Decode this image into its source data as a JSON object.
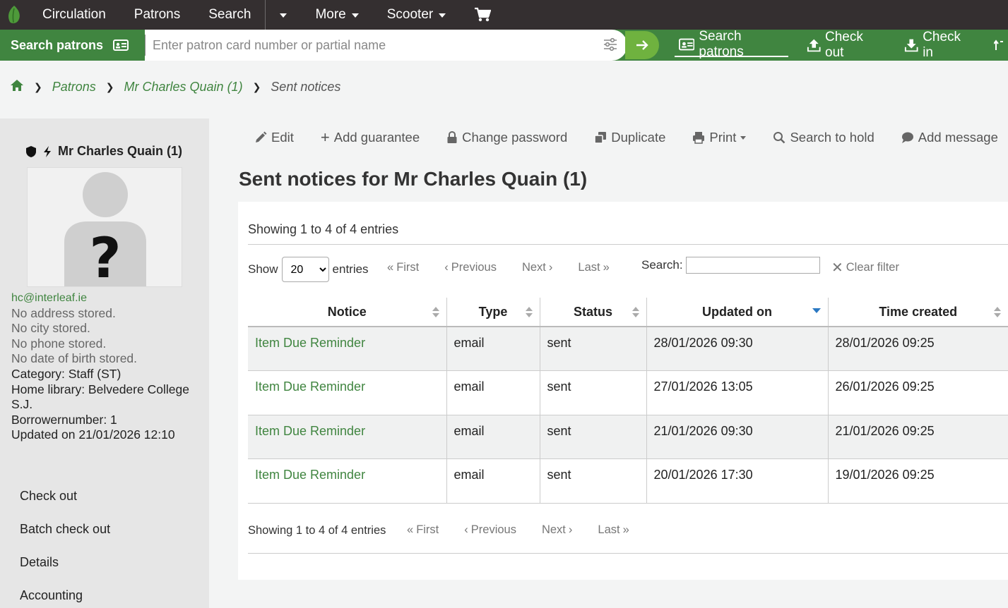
{
  "topnav": {
    "items": [
      "Circulation",
      "Patrons",
      "Search"
    ],
    "more_label": "More",
    "library_label": "Scooter"
  },
  "searchbar": {
    "label": "Search patrons",
    "placeholder": "Enter patron card number or partial name",
    "quicklinks": [
      {
        "label": "Search patrons",
        "icon": "id-card-icon",
        "active": true
      },
      {
        "label": "Check out",
        "icon": "upload-icon",
        "active": false
      },
      {
        "label": "Check in",
        "icon": "download-icon",
        "active": false
      }
    ]
  },
  "breadcrumb": {
    "items": [
      "Patrons",
      "Mr Charles Quain (1)"
    ],
    "current": "Sent notices"
  },
  "patron": {
    "name": "Mr Charles Quain (1)",
    "email": "hc@interleaf.ie",
    "address": "No address stored.",
    "city": "No city stored.",
    "phone": "No phone stored.",
    "dob": "No date of birth stored.",
    "category": "Category: Staff (ST)",
    "home_library": "Home library: Belvedere College S.J.",
    "borrowernumber": "Borrowernumber: 1",
    "updated": "Updated on 21/01/2026 12:10"
  },
  "sidemenu": [
    "Check out",
    "Batch check out",
    "Details",
    "Accounting"
  ],
  "toolbar": [
    "Edit",
    "Add guarantee",
    "Change password",
    "Duplicate",
    "Print",
    "Search to hold",
    "Add message"
  ],
  "page_title": "Sent notices for Mr Charles Quain (1)",
  "table_controls": {
    "info": "Showing 1 to 4 of 4 entries",
    "show_label": "Show",
    "entries_label": "entries",
    "page_size": "20",
    "first": "First",
    "previous": "Previous",
    "next": "Next",
    "last": "Last",
    "search_label": "Search:",
    "clear_filter": "Clear filter"
  },
  "table": {
    "headers": [
      "Notice",
      "Type",
      "Status",
      "Updated on",
      "Time created"
    ],
    "rows": [
      [
        "Item Due Reminder",
        "email",
        "sent",
        "28/01/2026 09:30",
        "28/01/2026 09:25"
      ],
      [
        "Item Due Reminder",
        "email",
        "sent",
        "27/01/2026 13:05",
        "26/01/2026 09:25"
      ],
      [
        "Item Due Reminder",
        "email",
        "sent",
        "21/01/2026 09:30",
        "21/01/2026 09:25"
      ],
      [
        "Item Due Reminder",
        "email",
        "sent",
        "20/01/2026 17:30",
        "19/01/2026 09:25"
      ]
    ]
  },
  "colors": {
    "topnav_bg": "#342f30",
    "brand_green": "#408540",
    "go_button": "#6fb23f",
    "sort_active": "#2a78c2"
  }
}
